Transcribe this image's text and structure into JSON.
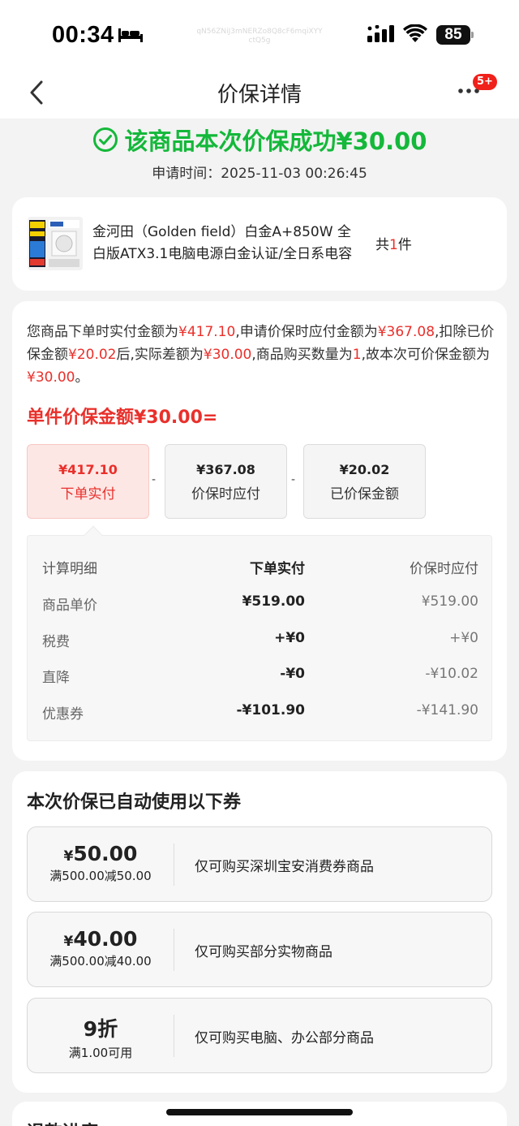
{
  "status_bar": {
    "time": "00:34",
    "watermark": "qN56ZNiJ3mNERZo8Q8cF6mqiXYYctQ5g",
    "battery": "85"
  },
  "nav": {
    "title": "价保详情",
    "badge": "5+"
  },
  "result": {
    "success_text": "该商品本次价保成功¥30.00",
    "apply_time": "申请时间：2025-11-03 00:26:45"
  },
  "product": {
    "title": "金河田（Golden field）白金A+850W 全白版ATX3.1电脑电源白金认证/全日系电容",
    "count_prefix": "共",
    "count_num": "1",
    "count_suffix": "件"
  },
  "explanation": {
    "t1": "您商品下单时实付金额为",
    "v1": "¥417.10",
    "t2": ",申请价保时应付金额为",
    "v2": "¥367.08",
    "t3": ",扣除已价保金额",
    "v3": "¥20.02",
    "t4": "后,实际差额为",
    "v4": "¥30.00",
    "t5": ",商品购买数量为",
    "v5": "1",
    "t6": ",故本次可价保金额为",
    "v6": "¥30.00",
    "t7": "。"
  },
  "formula": {
    "title": "单件价保金额¥30.00=",
    "minus": "-",
    "boxes": [
      {
        "amount": "¥417.10",
        "label": "下单实付"
      },
      {
        "amount": "¥367.08",
        "label": "价保时应付"
      },
      {
        "amount": "¥20.02",
        "label": "已价保金额"
      }
    ]
  },
  "calc": {
    "headers": [
      "计算明细",
      "下单实付",
      "价保时应付"
    ],
    "rows": [
      [
        "商品单价",
        "¥519.00",
        "¥519.00"
      ],
      [
        "税费",
        "+¥0",
        "+¥0"
      ],
      [
        "直降",
        "-¥0",
        "-¥10.02"
      ],
      [
        "优惠券",
        "-¥101.90",
        "-¥141.90"
      ]
    ]
  },
  "coupons": {
    "heading": "本次价保已自动使用以下券",
    "items": [
      {
        "yen": "¥",
        "value": "50.00",
        "condition": "满500.00减50.00",
        "desc": "仅可购买深圳宝安消费券商品"
      },
      {
        "yen": "¥",
        "value": "40.00",
        "condition": "满500.00减40.00",
        "desc": "仅可购买部分实物商品"
      },
      {
        "yen": "",
        "value": "9折",
        "condition": "满1.00可用",
        "desc": "仅可购买电脑、办公部分商品"
      }
    ]
  },
  "refund": {
    "title": "退款进度"
  },
  "colors": {
    "success": "#14b83a",
    "accent_red": "#e9302b",
    "badge_red": "#f0201a"
  },
  "icons": {
    "back": "chevron-left-icon",
    "more": "more-dots-icon",
    "success": "check-circle-icon",
    "signal": "cellular-signal-icon",
    "wifi": "wifi-icon",
    "sleep": "bed-icon"
  }
}
